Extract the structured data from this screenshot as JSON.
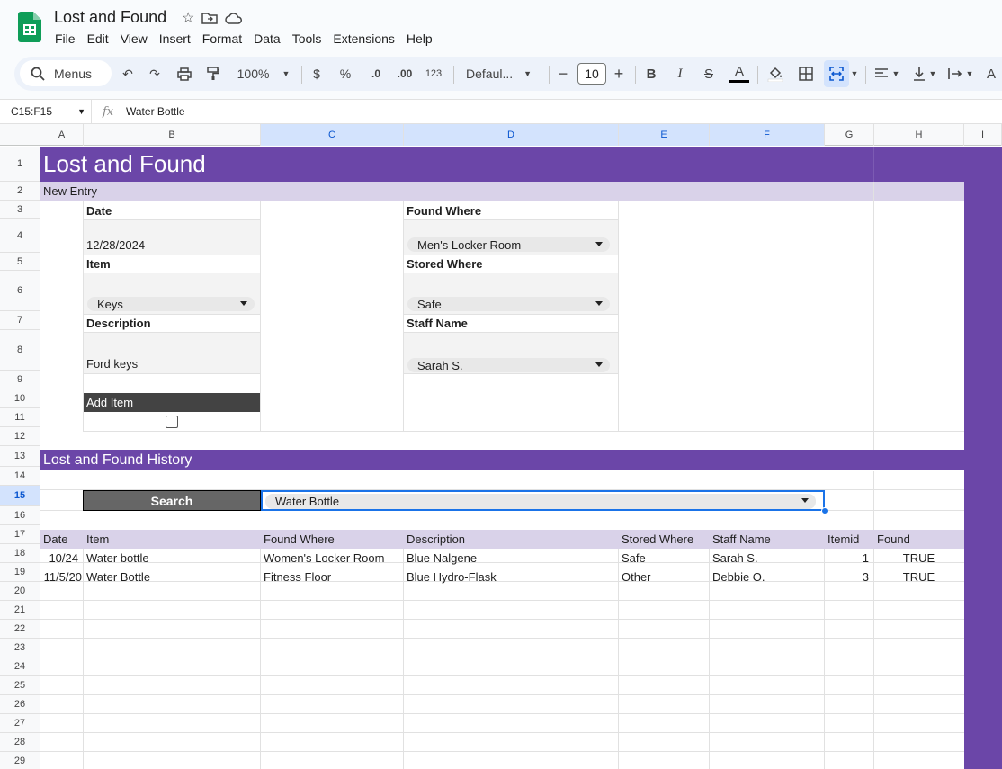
{
  "app": {
    "title": "Lost and Found"
  },
  "menu": [
    "File",
    "Edit",
    "View",
    "Insert",
    "Format",
    "Data",
    "Tools",
    "Extensions",
    "Help"
  ],
  "toolbar": {
    "menus_label": "Menus",
    "zoom": "100%",
    "currency": "$",
    "percent": "%",
    "dec_decrease": ".0",
    "dec_increase": ".00",
    "number_format": "123",
    "font": "Defaul...",
    "font_size": "10"
  },
  "formula_bar": {
    "name_box": "C15:F15",
    "fx": "fx",
    "value": "Water Bottle"
  },
  "columns": [
    "A",
    "B",
    "C",
    "D",
    "E",
    "F",
    "G",
    "H",
    "I"
  ],
  "rows": [
    "1",
    "2",
    "3",
    "4",
    "5",
    "6",
    "7",
    "8",
    "9",
    "10",
    "11",
    "12",
    "13",
    "14",
    "15",
    "16",
    "17",
    "18",
    "19",
    "20",
    "21",
    "22",
    "23",
    "24",
    "25",
    "26",
    "27",
    "28",
    "29"
  ],
  "sheet": {
    "title": "Lost and Found",
    "new_entry_label": "New Entry",
    "form": {
      "date_label": "Date",
      "date_value": "12/28/2024",
      "item_label": "Item",
      "item_value": "Keys",
      "description_label": "Description",
      "description_value": "Ford keys",
      "found_where_label": "Found Where",
      "found_where_value": "Men's Locker Room",
      "stored_where_label": "Stored Where",
      "stored_where_value": "Safe",
      "staff_name_label": "Staff Name",
      "staff_name_value": "Sarah S.",
      "add_item_label": "Add Item"
    },
    "history_title": "Lost and Found History",
    "search_label": "Search",
    "search_value": "Water Bottle",
    "table": {
      "headers": [
        "Date",
        "Item",
        "Found Where",
        "Description",
        "Stored Where",
        "Staff Name",
        "Itemid",
        "Found"
      ],
      "rows": [
        [
          "10/24",
          "Water bottle",
          "Women's Locker Room",
          "Blue Nalgene",
          "Safe",
          "Sarah S.",
          "1",
          "TRUE"
        ],
        [
          "11/5/20",
          "Water Bottle",
          "Fitness Floor",
          "Blue Hydro-Flask",
          "Other",
          "Debbie O.",
          "3",
          "TRUE"
        ]
      ]
    }
  },
  "colors": {
    "purple": "#6b46a8",
    "lavender": "#d9d2e9",
    "dark_gray": "#434343",
    "search_gray": "#666666",
    "form_gray": "#f3f3f3",
    "selection_blue": "#1a73e8"
  }
}
